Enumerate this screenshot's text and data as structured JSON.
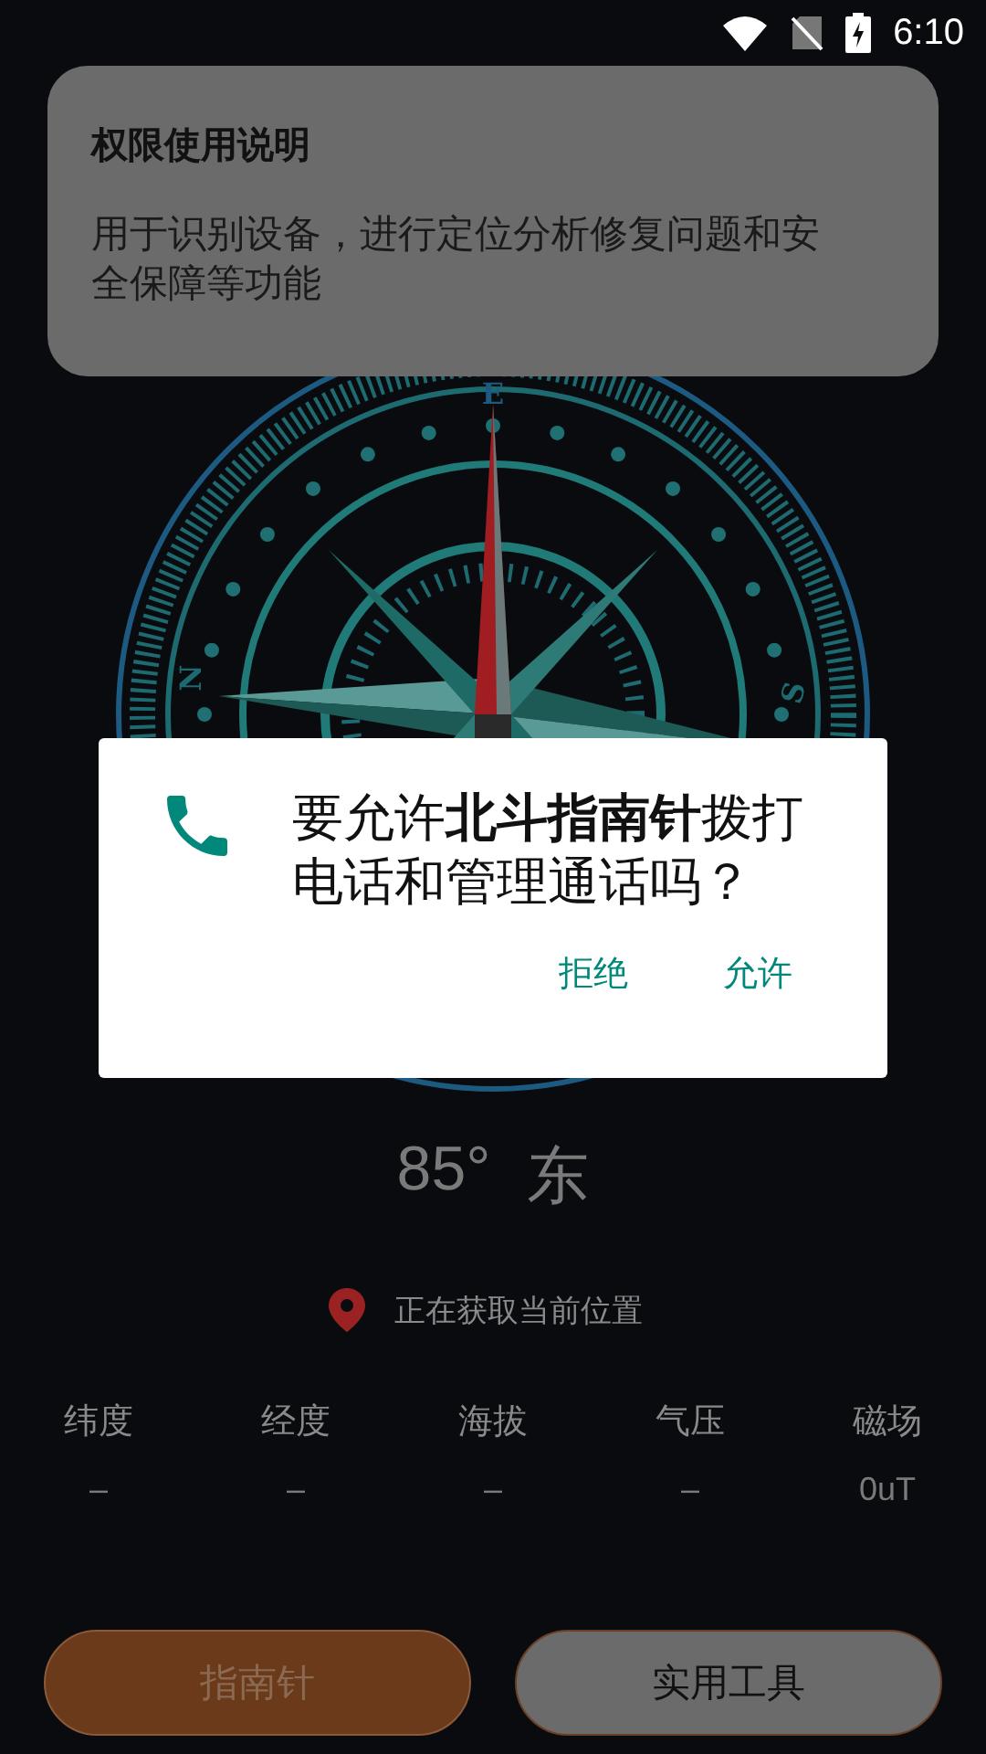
{
  "status_bar": {
    "time": "6:10"
  },
  "notice": {
    "title": "权限使用说明",
    "body": "用于识别设备，进行定位分析修复问题和安全保障等功能"
  },
  "compass": {
    "marks": [
      "E",
      "N",
      "S"
    ]
  },
  "permission_dialog": {
    "message": "要允许**北斗指南针**拨打电话和管理通话吗？",
    "buttons": [
      "拒绝",
      "允许"
    ]
  },
  "heading": {
    "degrees": "85°",
    "direction": "东"
  },
  "location": {
    "text": "正在获取当前位置"
  },
  "stats": [
    {
      "label": "纬度",
      "value": "–"
    },
    {
      "label": "经度",
      "value": "–"
    },
    {
      "label": "海拔",
      "value": "–"
    },
    {
      "label": "气压",
      "value": "–"
    },
    {
      "label": "磁场",
      "value": "0uT"
    }
  ],
  "tabs": [
    {
      "label": "指南针",
      "selected": true
    },
    {
      "label": "实用工具",
      "selected": false
    }
  ]
}
